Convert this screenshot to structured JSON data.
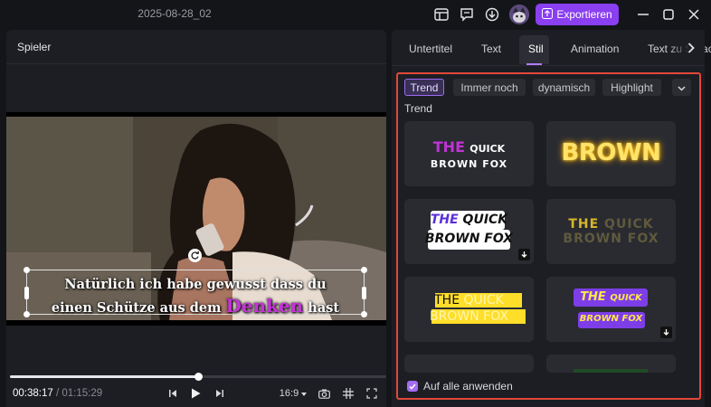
{
  "window": {
    "title": "2025-08-28_02"
  },
  "header": {
    "export_label": "Exportieren"
  },
  "player": {
    "title": "Spieler",
    "subtitle": {
      "line1": "Natürlich  ich habe gewusst  dass du",
      "line2_pre": "einen Schütze aus dem ",
      "line2_highlight": "Denken",
      "line2_post": " hast"
    },
    "current_time": "00:38:17",
    "separator": " / ",
    "total_time": "01:15:29",
    "progress": 0.5,
    "aspect_ratio": "16:9"
  },
  "side": {
    "tabs": [
      "Untertitel",
      "Text",
      "Stil",
      "Animation",
      "Text zu Sprache"
    ],
    "active_tab": "Stil",
    "chips": [
      "Trend",
      "Immer noch",
      "dynamisch",
      "Highlight"
    ],
    "active_chip": "Trend",
    "section_label": "Trend",
    "cards": [
      {
        "line1a": "THE",
        "line1b": "QUICK",
        "line2": "BROWN FOX"
      },
      {
        "line1": "BROWN"
      },
      {
        "line1a": "THE",
        "line1b": "QUICK",
        "line2": "BROWN FOX"
      },
      {
        "line1a": "THE",
        "line1b": "QUICK",
        "line2": "BROWN FOX"
      },
      {
        "line1a": "THE",
        "line1b": "QUICK",
        "line2": "BROWN FOX"
      },
      {
        "line1a": "THE",
        "line1b": "QUICK",
        "line2": "BROWN FOX"
      }
    ],
    "apply_all_label": "Auf alle anwenden",
    "apply_all_checked": true
  },
  "colors": {
    "accent": "#8a3ff0",
    "highlight_frame": "#e0483a",
    "subtitle_highlight": "#c633d9"
  }
}
